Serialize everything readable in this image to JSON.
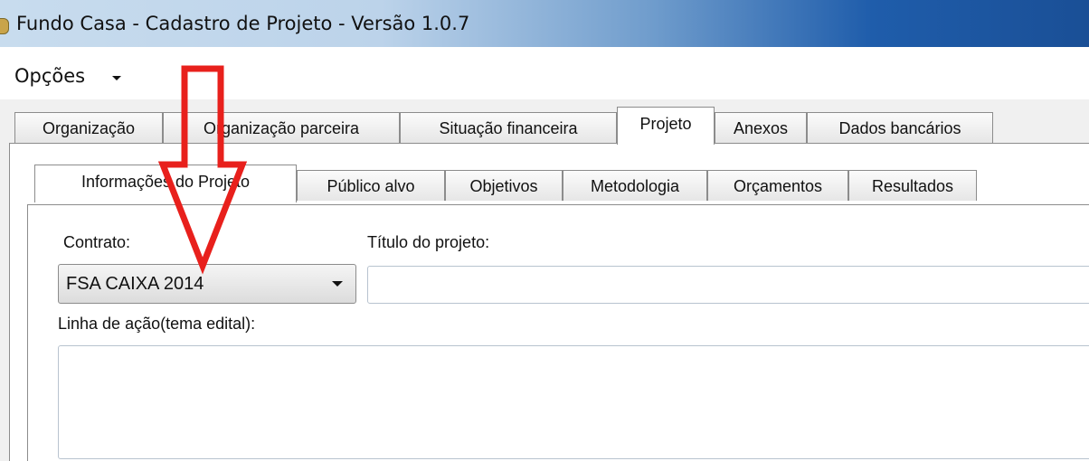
{
  "window": {
    "title": "Fundo Casa - Cadastro de Projeto - Versão 1.0.7"
  },
  "menu": {
    "options_label": "Opções"
  },
  "outer_tabs": [
    {
      "label": "Organização"
    },
    {
      "label": "Organização parceira"
    },
    {
      "label": "Situação financeira"
    },
    {
      "label": "Projeto",
      "active": true
    },
    {
      "label": "Anexos"
    },
    {
      "label": "Dados bancários"
    }
  ],
  "inner_tabs": [
    {
      "label": "Informações do Projeto",
      "active": true
    },
    {
      "label": "Público alvo"
    },
    {
      "label": "Objetivos"
    },
    {
      "label": "Metodologia"
    },
    {
      "label": "Orçamentos"
    },
    {
      "label": "Resultados"
    }
  ],
  "form": {
    "contract_label": "Contrato:",
    "contract_value": "FSA CAIXA 2014",
    "project_title_label": "Título do projeto:",
    "project_title_value": "",
    "action_line_label": "Linha de ação(tema edital):",
    "action_line_value": ""
  },
  "annotation": {
    "arrow_color": "#e8201c"
  },
  "colors": {
    "titlebar_accent": "#1f5dab"
  }
}
